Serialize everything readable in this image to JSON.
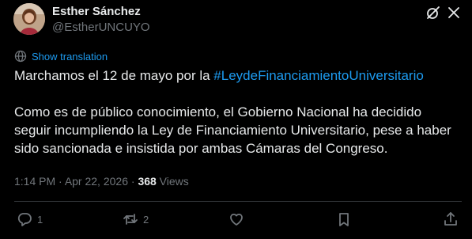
{
  "author": {
    "display_name": "Esther Sánchez",
    "handle": "@EstherUNCUYO"
  },
  "translate": {
    "label": "Show translation"
  },
  "tweet": {
    "line1_prefix": "Marchamos el 12 de mayo por la ",
    "hashtag": "#LeydeFinanciamientoUniversitario",
    "paragraph2": "Como es de público conocimiento, el Gobierno Nacional ha decidido seguir incumpliendo la Ley de Financiamiento Universitario, pese a haber sido sancionada e insistida por ambas Cámaras del Congreso."
  },
  "meta": {
    "time": "1:14 PM",
    "separator": " · ",
    "date": "Apr 22, 2026",
    "views_count": "368",
    "views_label": " Views"
  },
  "actions": {
    "reply_count": "1",
    "repost_count": "2"
  },
  "icons": {
    "grok": "grok-icon",
    "more": "close-x-icon",
    "translate": "translate-globe-icon",
    "reply": "reply-bubble-icon",
    "repost": "repost-arrows-icon",
    "like": "heart-icon",
    "bookmark": "bookmark-icon",
    "share": "share-upload-icon"
  },
  "colors": {
    "background": "#000000",
    "text": "#e7e9ea",
    "secondary": "#71767b",
    "link": "#1d9bf0",
    "divider": "#2f3336"
  }
}
